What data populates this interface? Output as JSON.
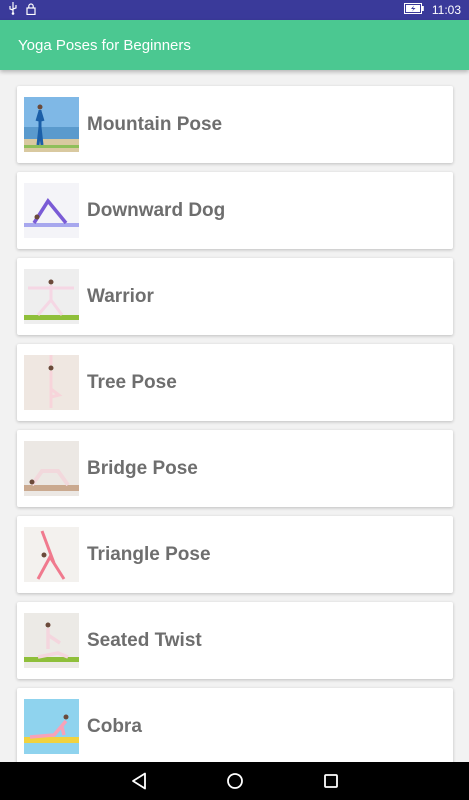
{
  "status_bar": {
    "time": "11:03",
    "icons": [
      "usb-icon",
      "lock-icon",
      "battery-charging-icon"
    ]
  },
  "app_bar": {
    "title": "Yoga Poses for Beginners"
  },
  "poses": [
    {
      "label": "Mountain Pose"
    },
    {
      "label": "Downward Dog"
    },
    {
      "label": "Warrior"
    },
    {
      "label": "Tree Pose"
    },
    {
      "label": "Bridge Pose"
    },
    {
      "label": "Triangle Pose"
    },
    {
      "label": "Seated Twist"
    },
    {
      "label": "Cobra"
    }
  ],
  "nav_bar": {
    "icons": [
      "back-icon",
      "home-icon",
      "recents-icon"
    ]
  }
}
